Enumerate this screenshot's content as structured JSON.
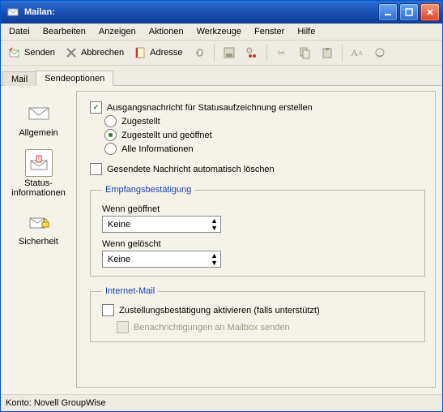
{
  "window": {
    "title": "Mailan:"
  },
  "menu": {
    "file": "Datei",
    "edit": "Bearbeiten",
    "view": "Anzeigen",
    "actions": "Aktionen",
    "tools": "Werkzeuge",
    "window": "Fenster",
    "help": "Hilfe"
  },
  "toolbar": {
    "send": "Senden",
    "cancel": "Abbrechen",
    "address": "Adresse"
  },
  "tabs": {
    "mail": "Mail",
    "sendoptions": "Sendeoptionen"
  },
  "sidebar": {
    "general": "Allgemein",
    "statusinfo": "Status-\ninformationen",
    "security": "Sicherheit"
  },
  "options": {
    "createOutgoing": "Ausgangsnachricht für Statusaufzeichnung erstellen",
    "delivered": "Zugestellt",
    "deliveredOpened": "Zugestellt und geöffnet",
    "allInfo": "Alle Informationen",
    "autoDelete": "Gesendete Nachricht automatisch löschen"
  },
  "receipt": {
    "legend": "Empfangsbestätigung",
    "whenOpened": "Wenn geöffnet",
    "whenDeleted": "Wenn gelöscht",
    "openedValue": "Keine",
    "deletedValue": "Keine"
  },
  "internet": {
    "legend": "Internet-Mail",
    "enableDelivery": "Zustellungsbestätigung aktivieren (falls unterstützt)",
    "sendToMailbox": "Benachrichtigungen an Mailbox senden"
  },
  "status": {
    "account": "Konto: Novell GroupWise"
  }
}
